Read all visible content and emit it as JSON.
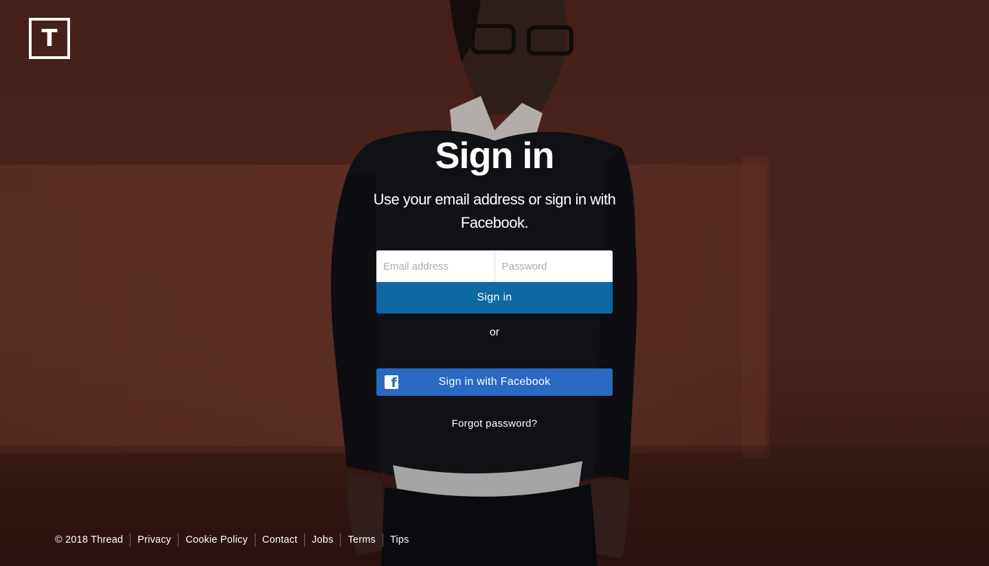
{
  "logo": {
    "letter": "T"
  },
  "signin": {
    "title": "Sign in",
    "subtitle": "Use your email address or sign in with Facebook.",
    "email_placeholder": "Email address",
    "password_placeholder": "Password",
    "submit_label": "Sign in",
    "or_label": "or",
    "facebook_label": "Sign in with Facebook",
    "forgot_label": "Forgot password?"
  },
  "footer": {
    "copyright": "© 2018 Thread",
    "links": [
      "Privacy",
      "Cookie Policy",
      "Contact",
      "Jobs",
      "Terms",
      "Tips"
    ]
  },
  "colors": {
    "primary_button": "#0d68a3",
    "facebook_button": "#2a69c2",
    "background": "#55261f"
  }
}
